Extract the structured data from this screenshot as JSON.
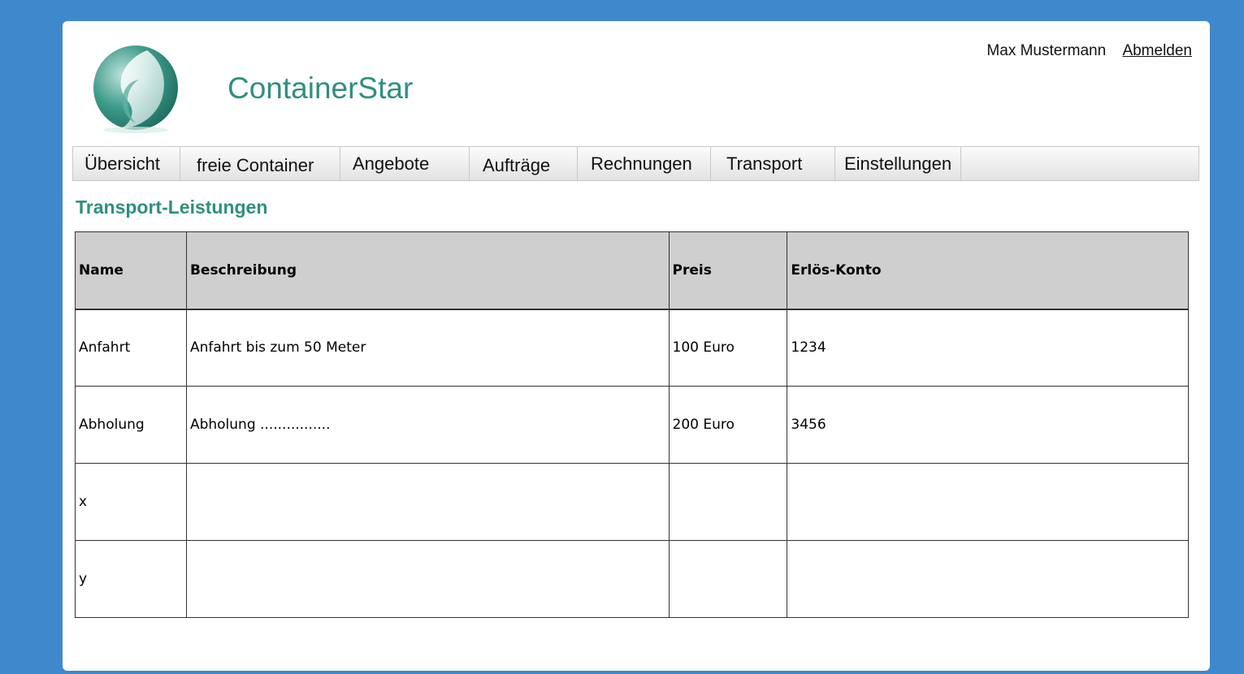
{
  "header": {
    "app_title": "ContainerStar",
    "user_name": "Max Mustermann",
    "logout_label": "Abmelden",
    "brand_color": "#2f8f80",
    "logo_icon": "containerstar-logo"
  },
  "nav": {
    "items": [
      {
        "label": "Übersicht"
      },
      {
        "label": "freie Container"
      },
      {
        "label": "Angebote"
      },
      {
        "label": "Aufträge"
      },
      {
        "label": "Rechnungen"
      },
      {
        "label": "Transport"
      },
      {
        "label": "Einstellungen"
      }
    ]
  },
  "main": {
    "section_title": "Transport-Leistungen",
    "table": {
      "headers": [
        "Name",
        "Beschreibung",
        "Preis",
        "Erlös-Konto"
      ],
      "rows": [
        [
          "Anfahrt",
          "Anfahrt bis zum 50 Meter",
          "100 Euro",
          "1234"
        ],
        [
          "Abholung",
          "Abholung ................",
          "200 Euro",
          "3456"
        ],
        [
          "x",
          "",
          "",
          ""
        ],
        [
          "y",
          "",
          "",
          ""
        ]
      ]
    }
  },
  "colors": {
    "page_background": "#3f88cb",
    "table_header_bg": "#cfcfcf"
  }
}
